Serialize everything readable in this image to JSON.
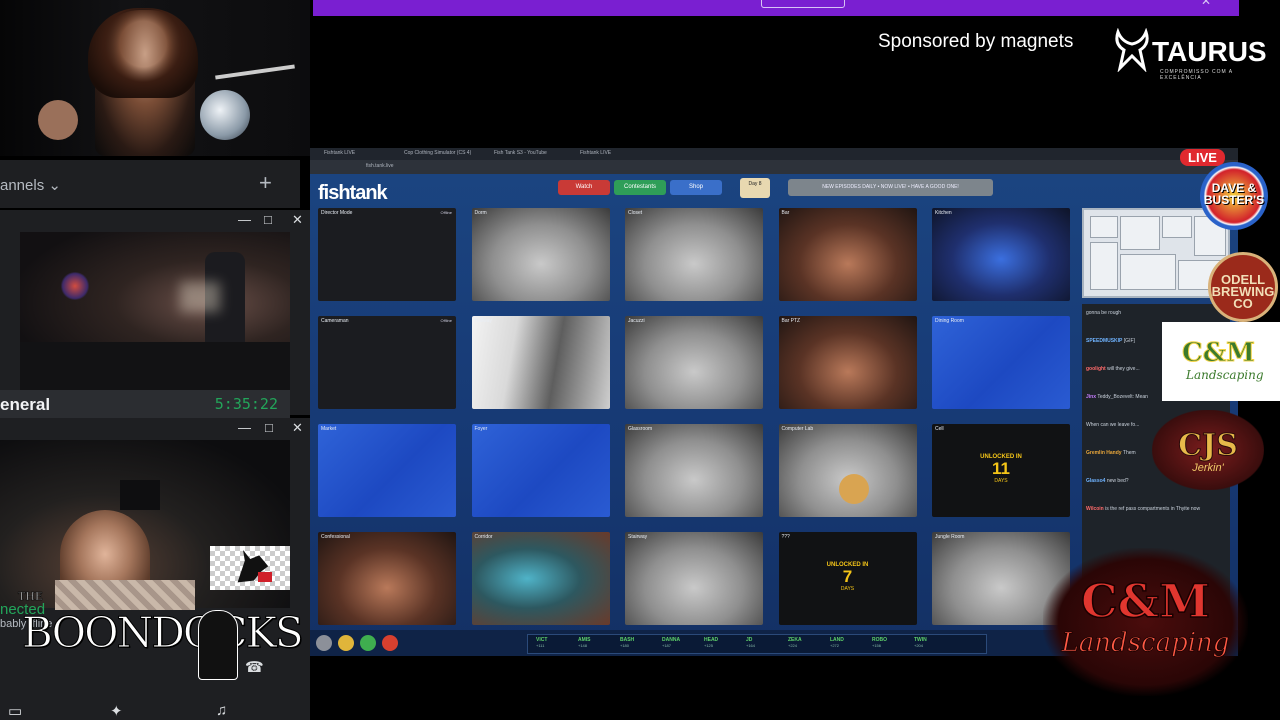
{
  "sponsor": {
    "text": "Sponsored by magnets"
  },
  "taurus": {
    "name": "TAURUS",
    "tagline": "COMPROMISSO COM A EXCELÊNCIA"
  },
  "discord": {
    "channels_label": "annels",
    "add_icon": "plus-icon",
    "popout1": {
      "channel": "eneral",
      "timer": "5:35:22"
    },
    "popout2": {
      "status": "nected",
      "substatus": "bably ffline"
    },
    "window_controls": [
      "—",
      "□",
      "✕"
    ]
  },
  "boondocks": {
    "the": "THE",
    "title": "BOONDOCKS"
  },
  "browser": {
    "tabs": [
      "Fishtank LIVE",
      "Cop Clothing Simulator (CS 4)",
      "Fish Tank S3 - YouTube",
      "Fishtank LIVE"
    ],
    "url": "fish.tank.live",
    "logo": "fishtank",
    "pills": [
      {
        "label": "Watch",
        "color": "#c93a36"
      },
      {
        "label": "Contestants",
        "color": "#2f9e58"
      },
      {
        "label": "Shop",
        "color": "#3a6fc9"
      }
    ],
    "day": "Day 8",
    "notice": "NEW EPISODES DAILY • NOW LIVE! • HAVE A GOOD ONE!",
    "live_badge": "LIVE"
  },
  "cameras": [
    {
      "label": "Director Mode",
      "status": "Offline",
      "style": "dark"
    },
    {
      "label": "Dorm",
      "status": "",
      "style": "gray"
    },
    {
      "label": "Closet",
      "status": "",
      "style": "gray"
    },
    {
      "label": "Bar",
      "status": "",
      "style": "warm"
    },
    {
      "label": "Kitchen",
      "status": "",
      "style": "cold"
    },
    {
      "label": "Cameraman",
      "status": "Offline",
      "style": "dark"
    },
    {
      "label": "Hallway",
      "status": "",
      "style": "hall"
    },
    {
      "label": "Jacuzzi",
      "status": "",
      "style": "gray"
    },
    {
      "label": "Bar PTZ",
      "status": "",
      "style": "warm"
    },
    {
      "label": "Dining Room",
      "status": "",
      "style": "blue"
    },
    {
      "label": "Market",
      "status": "",
      "style": "blue"
    },
    {
      "label": "Foyer",
      "status": "",
      "style": "blue"
    },
    {
      "label": "Glassroom",
      "status": "",
      "style": "gray"
    },
    {
      "label": "Computer Lab",
      "status": "",
      "style": "gray"
    },
    {
      "label": "Cell",
      "status": "",
      "style": "black",
      "lock": {
        "top": "UNLOCKED IN",
        "num": "11",
        "bottom": "DAYS"
      }
    },
    {
      "label": "Confessional",
      "status": "",
      "style": "warm"
    },
    {
      "label": "Corridor",
      "status": "",
      "style": "teal"
    },
    {
      "label": "Stairway",
      "status": "",
      "style": "gray"
    },
    {
      "label": "???",
      "status": "",
      "style": "black",
      "lock": {
        "top": "UNLOCKED IN",
        "num": "7",
        "bottom": "DAYS"
      }
    },
    {
      "label": "Jungle Room",
      "status": "",
      "style": "gray"
    }
  ],
  "chat": [
    {
      "user": "",
      "text": "gonna be rough"
    },
    {
      "user": "SPEEDMUSKIP",
      "text": "[GIF]"
    },
    {
      "user": "goolight",
      "text": "will they give..."
    },
    {
      "user": "Jinx",
      "text": "Teddy_Bozevelt: Mean"
    },
    {
      "user": "",
      "text": "When can we leave fo..."
    },
    {
      "user": "Gremlin Handy",
      "text": "Them"
    },
    {
      "user": "Glasso4",
      "text": "new bed?"
    },
    {
      "user": "Wilcoin",
      "text": "is the ref pass compartments in Thyite now"
    }
  ],
  "roster": [
    {
      "name": "VICT",
      "val": "+111"
    },
    {
      "name": "AMIS",
      "val": "+148"
    },
    {
      "name": "BASH",
      "val": "+180"
    },
    {
      "name": "DANNA",
      "val": "+187"
    },
    {
      "name": "HEAD",
      "val": "+125"
    },
    {
      "name": "JD",
      "val": "+164"
    },
    {
      "name": "ZEKA",
      "val": "+224"
    },
    {
      "name": "LAND",
      "val": "+272"
    },
    {
      "name": "ROBO",
      "val": "+156"
    },
    {
      "name": "TWIN",
      "val": "+204"
    }
  ],
  "sponsors_right": [
    {
      "name": "DAVE & BUSTER'S"
    },
    {
      "name": "ODELL BREWING CO"
    },
    {
      "name": "C&M",
      "sub": "Landscaping"
    },
    {
      "name": "CJS",
      "sub": "Jerkin'"
    },
    {
      "name": "C&M",
      "sub": "Landscaping"
    }
  ]
}
